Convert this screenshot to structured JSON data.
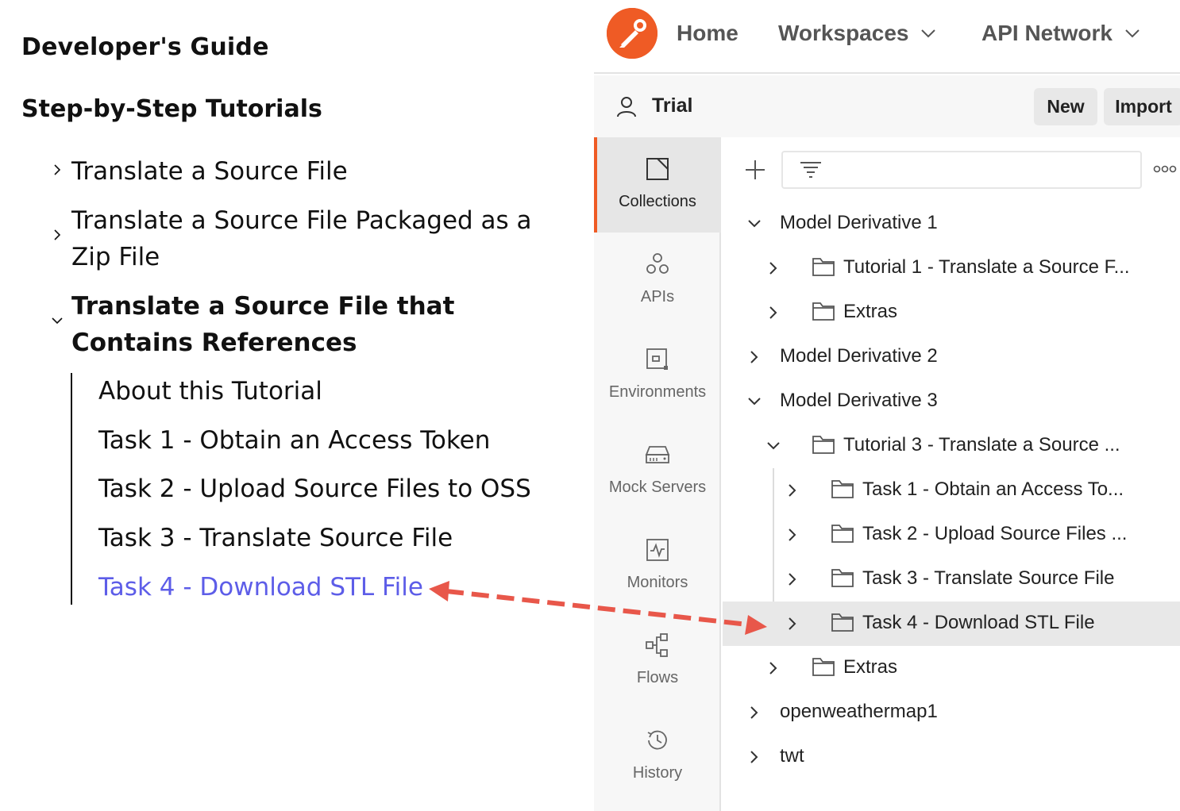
{
  "guide": {
    "title": "Developer's Guide",
    "subtitle": "Step-by-Step Tutorials",
    "items": [
      {
        "label": "Translate a Source File",
        "expanded": false
      },
      {
        "label": "Translate a Source File Packaged as a Zip File",
        "expanded": false
      },
      {
        "label": "Translate a Source File that Contains References",
        "expanded": true
      }
    ],
    "subitems": [
      {
        "label": "About this Tutorial"
      },
      {
        "label": "Task 1 - Obtain an Access Token"
      },
      {
        "label": "Task 2 - Upload Source Files to OSS"
      },
      {
        "label": "Task 3 - Translate Source File"
      },
      {
        "label": "Task 4 - Download STL File",
        "active": true
      }
    ],
    "active_color": "#5d5de8"
  },
  "postman": {
    "brand_color": "#ef5b25",
    "nav": {
      "home": "Home",
      "workspaces": "Workspaces",
      "api_network": "API Network"
    },
    "workspace": {
      "name": "Trial",
      "new_label": "New",
      "import_label": "Import"
    },
    "sidebar": [
      {
        "label": "Collections",
        "icon": "collections-icon",
        "active": true
      },
      {
        "label": "APIs",
        "icon": "apis-icon"
      },
      {
        "label": "Environments",
        "icon": "environments-icon"
      },
      {
        "label": "Mock Servers",
        "icon": "mock-servers-icon"
      },
      {
        "label": "Monitors",
        "icon": "monitors-icon"
      },
      {
        "label": "Flows",
        "icon": "flows-icon"
      },
      {
        "label": "History",
        "icon": "history-icon"
      }
    ],
    "tree": [
      {
        "label": "Model Derivative 1",
        "expanded": true,
        "folder": false
      },
      {
        "label": "Tutorial 1 - Translate a Source F...",
        "expanded": false,
        "folder": true
      },
      {
        "label": "Extras",
        "expanded": false,
        "folder": true
      },
      {
        "label": "Model Derivative 2",
        "expanded": false,
        "folder": false
      },
      {
        "label": "Model Derivative 3",
        "expanded": true,
        "folder": false
      },
      {
        "label": "Tutorial 3 - Translate a Source ...",
        "expanded": true,
        "folder": true
      },
      {
        "label": "Task 1 - Obtain an Access To...",
        "expanded": false,
        "folder": true
      },
      {
        "label": "Task 2 - Upload Source Files ...",
        "expanded": false,
        "folder": true
      },
      {
        "label": "Task 3 - Translate Source File",
        "expanded": false,
        "folder": true
      },
      {
        "label": "Task 4 - Download STL File",
        "expanded": false,
        "folder": true,
        "selected": true
      },
      {
        "label": "Extras",
        "expanded": false,
        "folder": true
      },
      {
        "label": "openweathermap1",
        "expanded": false,
        "folder": false
      },
      {
        "label": "twt",
        "expanded": false,
        "folder": false
      }
    ]
  },
  "annotation": {
    "arrow_color": "#e8574a"
  }
}
